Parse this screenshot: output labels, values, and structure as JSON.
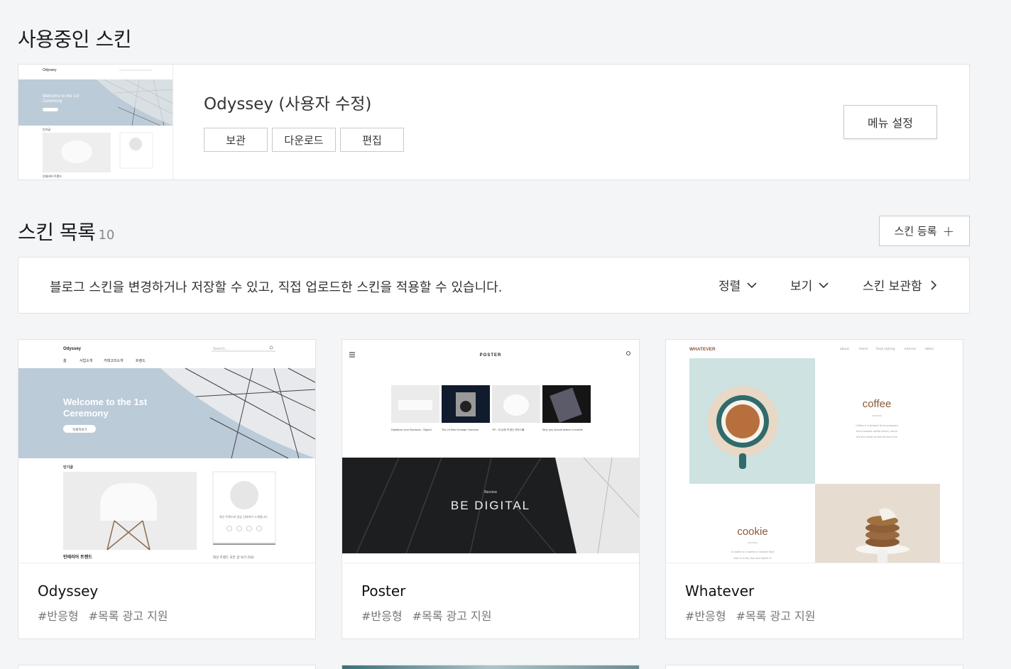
{
  "current_section": {
    "title": "사용중인 스킨"
  },
  "current_skin": {
    "name": "Odyssey (사용자 수정)",
    "buttons": {
      "archive": "보관",
      "download": "다운로드",
      "edit": "편집"
    },
    "menu_settings": "메뉴 설정",
    "thumb": {
      "brand": "Odyssey",
      "hero": "Welcome to the 1st Ceremony",
      "section": "인기글",
      "caption": "인테리어 트렌드"
    }
  },
  "list_section": {
    "title": "스킨 목록",
    "count": "10",
    "register_label": "스킨 등록"
  },
  "infobar": {
    "description": "블로그 스킨을 변경하거나 저장할 수 있고, 직접 업로드한 스킨을 적용할 수 있습니다.",
    "sort_label": "정렬",
    "view_label": "보기",
    "storage_label": "스킨 보관함"
  },
  "skins": [
    {
      "name": "Odyssey",
      "tags": [
        "#반응형",
        "#목록 광고 지원"
      ],
      "preview": {
        "brand": "Odyssey",
        "search": "Search...",
        "nav": [
          "홈",
          "사업소개",
          "카테고리소개",
          "트렌드"
        ],
        "hero": "Welcome to the 1st Ceremony",
        "hero_button": "자세히보기",
        "section": "인기글",
        "caption": "인테리어 트렌드",
        "side_caption": "최신 트렌드 모든 글 보기 (54)"
      }
    },
    {
      "name": "Poster",
      "tags": [
        "#반응형",
        "#목록 광고 지원"
      ],
      "preview": {
        "brand": "POSTER",
        "banner_small": "Review",
        "banner": "BE DIGITAL"
      }
    },
    {
      "name": "Whatever",
      "tags": [
        "#반응형",
        "#목록 광고 지원"
      ],
      "preview": {
        "brand": "WHATEVER",
        "nav": [
          "about",
          "trend",
          "food styling",
          "interior",
          "fabric"
        ],
        "coffee": "coffee",
        "cookie": "cookie"
      }
    }
  ],
  "colors": {
    "background": "#f4f5f7",
    "card": "#ffffff",
    "border": "#e2e3e6",
    "hero_blue": "#bccbd8",
    "poster_dark": "#1d1e20",
    "coffee_bg": "#cde2e1",
    "whatever_brand": "#8a5a3a"
  }
}
